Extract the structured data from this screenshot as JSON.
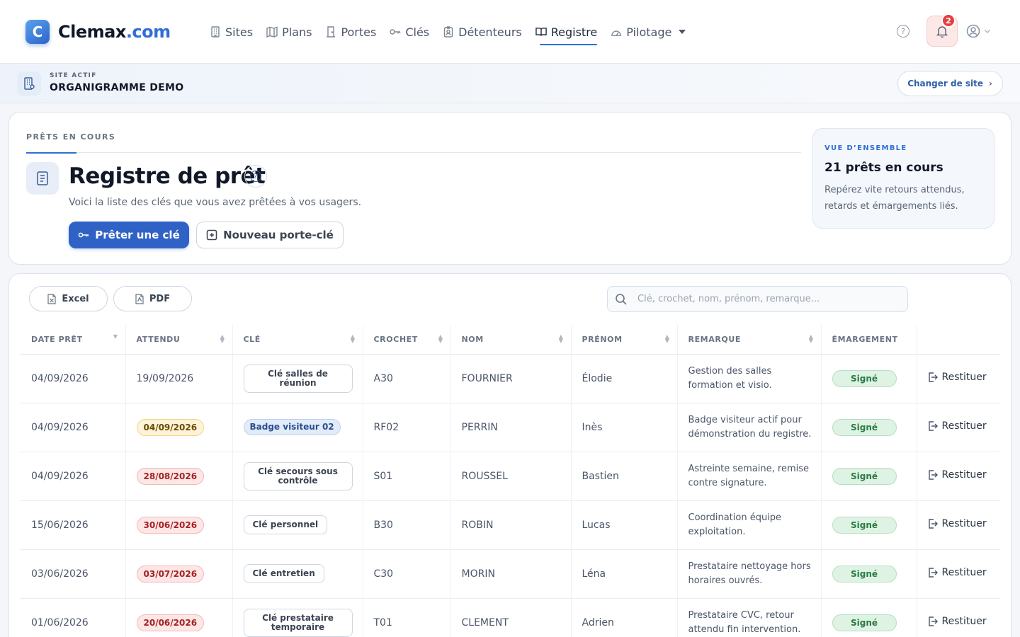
{
  "brand": {
    "name": "Clemax",
    "tld": ".com",
    "mark": "C"
  },
  "nav": [
    {
      "label": "Sites",
      "icon": "building-icon"
    },
    {
      "label": "Plans",
      "icon": "map-icon"
    },
    {
      "label": "Portes",
      "icon": "door-icon"
    },
    {
      "label": "Clés",
      "icon": "key-icon"
    },
    {
      "label": "Détenteurs",
      "icon": "badge-icon"
    },
    {
      "label": "Registre",
      "icon": "book-icon",
      "active": true
    },
    {
      "label": "Pilotage",
      "icon": "gauge-icon"
    }
  ],
  "notifications": {
    "count": "2"
  },
  "site": {
    "kicker": "SITE ACTIF",
    "name": "ORGANIGRAMME DEMO",
    "change_label": "Changer de site"
  },
  "header": {
    "kicker": "PRÊTS EN COURS",
    "title": "Registre de prêt",
    "subtitle": "Voici la liste des clés que vous avez prêtées à vos usagers.",
    "primary_button": "Prêter une clé",
    "secondary_button": "Nouveau porte-clé"
  },
  "overview": {
    "kicker": "VUE D’ENSEMBLE",
    "title": "21 prêts en cours",
    "text": "Repérez vite retours attendus, retards et émargements liés."
  },
  "toolbar": {
    "excel_label": "Excel",
    "pdf_label": "PDF",
    "search_placeholder": "Clé, crochet, nom, prénom, remarque..."
  },
  "table": {
    "columns": [
      "DATE PRÊT",
      "ATTENDU",
      "CLÉ",
      "CROCHET",
      "NOM",
      "PRÉNOM",
      "REMARQUE",
      "ÉMARGEMENT"
    ],
    "rows": [
      {
        "date": "04/09/2026",
        "expected": "19/09/2026",
        "expected_status": "normal",
        "key": "Clé salles de réunion",
        "key_style": "wide",
        "hook": "A30",
        "last": "FOURNIER",
        "first": "Élodie",
        "remark": "Gestion des salles formation et visio.",
        "signature": "Signé",
        "action": "Restituer"
      },
      {
        "date": "04/09/2026",
        "expected": "04/09/2026",
        "expected_status": "warn",
        "key": "Badge visiteur 02",
        "key_style": "badge",
        "hook": "RF02",
        "last": "PERRIN",
        "first": "Inès",
        "remark": "Badge visiteur actif pour démonstration du registre.",
        "signature": "Signé",
        "action": "Restituer"
      },
      {
        "date": "04/09/2026",
        "expected": "28/08/2026",
        "expected_status": "late",
        "key": "Clé secours sous contrôle",
        "key_style": "wide",
        "hook": "S01",
        "last": "ROUSSEL",
        "first": "Bastien",
        "remark": "Astreinte semaine, remise contre signature.",
        "signature": "Signé",
        "action": "Restituer"
      },
      {
        "date": "15/06/2026",
        "expected": "30/06/2026",
        "expected_status": "late",
        "key": "Clé personnel",
        "key_style": "normal",
        "hook": "B30",
        "last": "ROBIN",
        "first": "Lucas",
        "remark": "Coordination équipe exploitation.",
        "signature": "Signé",
        "action": "Restituer"
      },
      {
        "date": "03/06/2026",
        "expected": "03/07/2026",
        "expected_status": "late",
        "key": "Clé entretien",
        "key_style": "normal",
        "hook": "C30",
        "last": "MORIN",
        "first": "Léna",
        "remark": "Prestataire nettoyage hors horaires ouvrés.",
        "signature": "Signé",
        "action": "Restituer"
      },
      {
        "date": "01/06/2026",
        "expected": "20/06/2026",
        "expected_status": "late",
        "key": "Clé prestataire temporaire",
        "key_style": "wide",
        "hook": "T01",
        "last": "CLEMENT",
        "first": "Adrien",
        "remark": "Prestataire CVC, retour attendu fin intervention.",
        "signature": "Signé",
        "action": "Restituer"
      }
    ]
  }
}
